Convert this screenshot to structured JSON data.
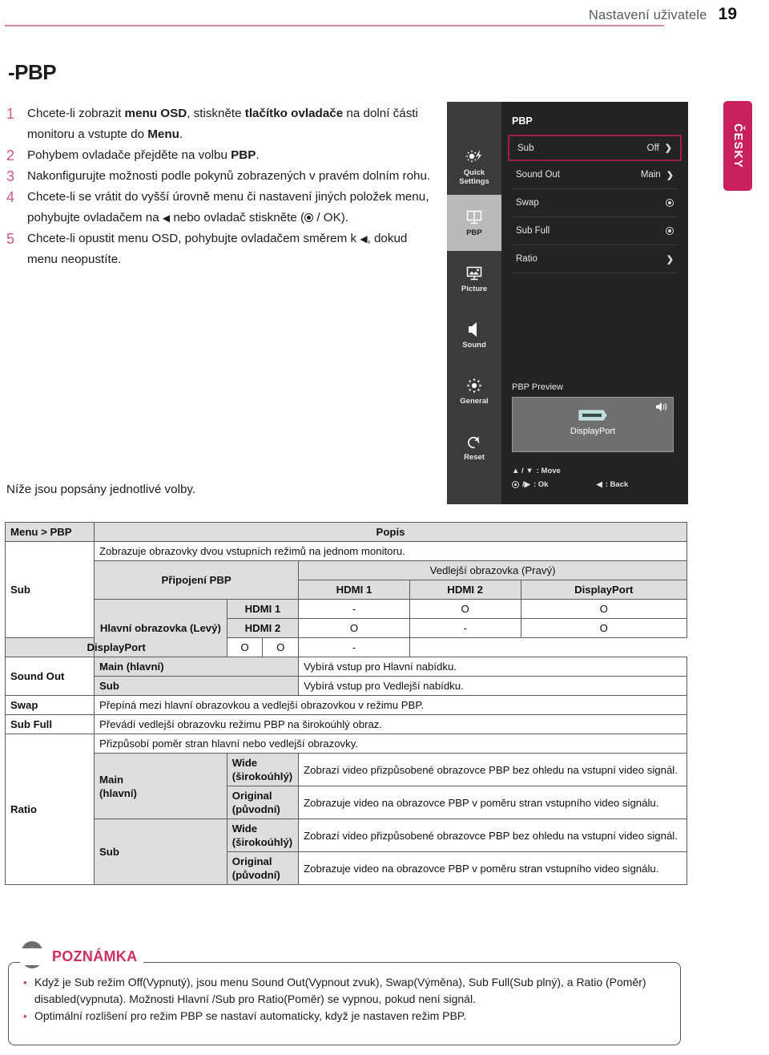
{
  "header": {
    "title": "Nastavení uživatele",
    "page_number": "19",
    "rule_color": "#d88b9f"
  },
  "section_title": "-PBP",
  "language_tab": {
    "label": "ČESKY",
    "color": "#c8205c"
  },
  "steps": [
    {
      "num": "1",
      "html": "Chcete-li zobrazit <b>menu OSD</b>, stiskněte <b>tlačítko ovladače</b> na dolní části monitoru a vstupte do <b>Menu</b>."
    },
    {
      "num": "2",
      "html": "Pohybem ovladače přejděte na volbu <b>PBP</b>."
    },
    {
      "num": "3",
      "html": "Nakonfigurujte možnosti podle pokynů zobrazených v pravém dolním rohu."
    },
    {
      "num": "4",
      "html": "Chcete-li se vrátit do vyšší úrovně menu či nastavení jiných položek menu, pohybujte ovladačem na <span class=\"arrow-l\">◀</span> nebo ovladač stiskněte (<span class=\"ok-dot\"></span> / OK)."
    },
    {
      "num": "5",
      "html": "Chcete-li opustit menu OSD, pohybujte ovladačem směrem k <span class=\"arrow-l\">◀</span>, dokud menu neopustíte."
    }
  ],
  "below_note": "Níže jsou popsány jednotlivé volby.",
  "osd": {
    "title": "PBP",
    "sidebar": [
      {
        "label": "Quick\nSettings",
        "icon": "quick-settings-icon",
        "active": false
      },
      {
        "label": "PBP",
        "icon": "pbp-icon",
        "active": true
      },
      {
        "label": "Picture",
        "icon": "picture-icon",
        "active": false
      },
      {
        "label": "Sound",
        "icon": "sound-icon",
        "active": false
      },
      {
        "label": "General",
        "icon": "gear-icon",
        "active": false
      },
      {
        "label": "Reset",
        "icon": "reset-icon",
        "active": false
      }
    ],
    "rows": [
      {
        "label": "Sub",
        "value": "Off",
        "control": "chevron",
        "highlight": true
      },
      {
        "label": "Sound Out",
        "value": "Main",
        "control": "chevron",
        "highlight": false
      },
      {
        "label": "Swap",
        "value": "",
        "control": "radio",
        "highlight": false
      },
      {
        "label": "Sub Full",
        "value": "",
        "control": "radio",
        "highlight": false
      },
      {
        "label": "Ratio",
        "value": "",
        "control": "chevron",
        "highlight": false
      }
    ],
    "preview": {
      "label": "PBP Preview",
      "source": "DisplayPort"
    },
    "hints": {
      "move": ": Move",
      "move_keys": "▲ / ▼",
      "ok": ": Ok",
      "ok_keys": "/▶",
      "back": ": Back",
      "back_keys": "◀"
    },
    "highlight_color": "#9e1d4d"
  },
  "table": {
    "header": {
      "menu": "Menu > PBP",
      "desc": "Popis"
    },
    "sub": {
      "label": "Sub",
      "desc": "Zobrazuje obrazovky dvou vstupních režimů na jednom monitoru.",
      "matrix_head_left": "Připojení PBP",
      "matrix_head_right": "Vedlejší obrazovka (Pravý)",
      "cols": [
        "HDMI 1",
        "HDMI 2",
        "DisplayPort"
      ],
      "row_group": "Hlavní obrazovka (Levý)",
      "rows": [
        {
          "name": "HDMI 1",
          "values": [
            "-",
            "O",
            "O"
          ]
        },
        {
          "name": "HDMI 2",
          "values": [
            "O",
            "-",
            "O"
          ]
        },
        {
          "name": "DisplayPort",
          "values": [
            "O",
            "O",
            "-"
          ]
        }
      ]
    },
    "sound_out": {
      "label": "Sound Out",
      "items": [
        {
          "name": "Main (hlavní)",
          "desc": "Vybírá vstup pro Hlavní nabídku."
        },
        {
          "name": "Sub",
          "desc": "Vybírá vstup pro Vedlejší nabídku."
        }
      ]
    },
    "swap": {
      "label": "Swap",
      "desc": "Přepíná mezi hlavní obrazovkou a vedlejší obrazovkou v režimu PBP."
    },
    "sub_full": {
      "label": "Sub Full",
      "desc": "Převádí vedlejší obrazovku režimu PBP na širokoúhlý obraz."
    },
    "ratio": {
      "label": "Ratio",
      "desc": "Přizpůsobí poměr stran hlavní nebo vedlejší obrazovky.",
      "groups": [
        {
          "name": "Main (hlavní)",
          "items": [
            {
              "name": "Wide (širokoúhlý)",
              "desc": "Zobrazí video přizpůsobené obrazovce PBP bez ohledu na vstupní video signál."
            },
            {
              "name": "Original (původní)",
              "desc": "Zobrazuje video na obrazovce PBP v poměru stran vstupního video signálu."
            }
          ]
        },
        {
          "name": "Sub",
          "items": [
            {
              "name": "Wide (širokoúhlý)",
              "desc": "Zobrazí video přizpůsobené obrazovce PBP bez ohledu na vstupní video signál."
            },
            {
              "name": "Original (původní)",
              "desc": "Zobrazuje video na obrazovce PBP v poměru stran vstupního video signálu."
            }
          ]
        }
      ]
    }
  },
  "note": {
    "title": "POZNÁMKA",
    "items": [
      "Když je Sub režim Off(Vypnutý), jsou menu Sound Out(Vypnout zvuk), Swap(Výměna), Sub Full(Sub plný), a Ratio (Poměr) disabled(vypnuta). Možnosti Hlavní /Sub pro Ratio(Poměr) se vypnou, pokud není signál.",
      "Optimální rozlišení pro režim PBP se nastaví automaticky, když je nastaven režim PBP."
    ],
    "accent": "#cf2e60"
  }
}
